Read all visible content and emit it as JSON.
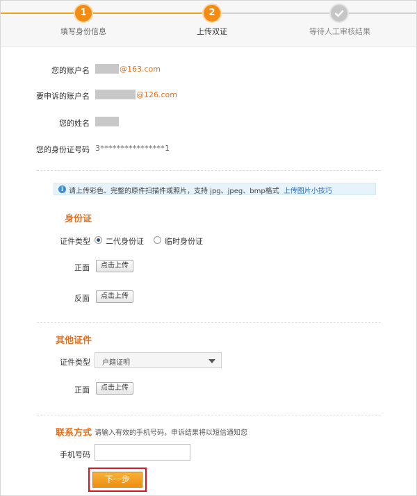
{
  "steps": [
    {
      "number": "1",
      "label": "填写身份信息",
      "state": "done"
    },
    {
      "number": "2",
      "label": "上传双证",
      "state": "current"
    },
    {
      "number": "",
      "label": "等待人工审核结果",
      "state": "pending",
      "icon": "check-icon"
    }
  ],
  "account": {
    "your_account_label": "您的账户名",
    "your_account_suffix": "@163.com",
    "appeal_account_label": "要申诉的账户名",
    "appeal_account_suffix": "@126.com",
    "name_label": "您的姓名",
    "id_label": "您的身份证号码",
    "id_value": "3****************1"
  },
  "tip": {
    "icon": "info-icon",
    "text": "请上传彩色、完整的原件扫描件或照片，支持 jpg、jpeg、bmp格式",
    "link": "上传图片小技巧"
  },
  "id_card": {
    "title": "身份证",
    "type_label": "证件类型",
    "options": [
      "二代身份证",
      "临时身份证"
    ],
    "selected": "二代身份证",
    "front_label": "正面",
    "back_label": "反面",
    "upload_label": "点击上传"
  },
  "other_doc": {
    "title": "其他证件",
    "type_label": "证件类型",
    "selected_type": "户籍证明",
    "front_label": "正面",
    "upload_label": "点击上传"
  },
  "contact": {
    "title": "联系方式",
    "hint": "请输入有效的手机号码，申诉结果将以短信通知您",
    "phone_label": "手机号码",
    "phone_value": ""
  },
  "next_button": "下一步",
  "colors": {
    "accent": "#f48b12",
    "link": "#2d6fb4",
    "section_title": "#e8701a",
    "highlight_border": "#d8161b"
  }
}
